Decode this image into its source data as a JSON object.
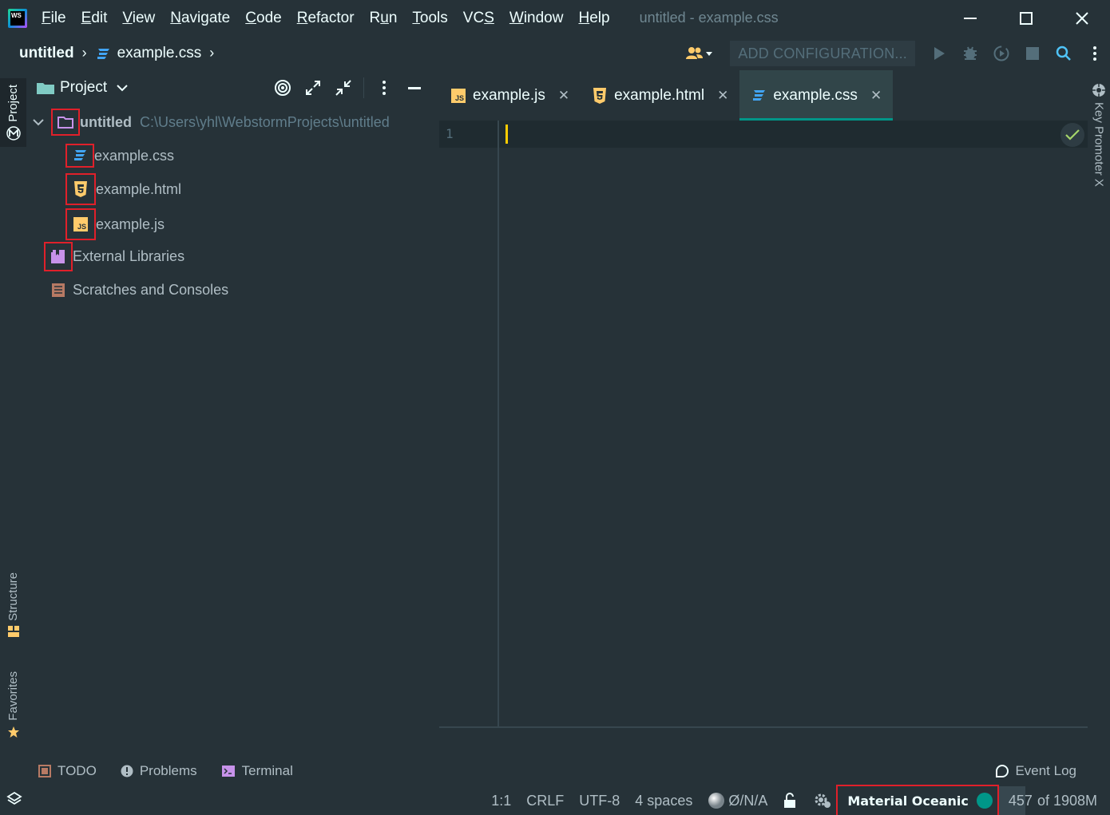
{
  "menu": {
    "items": [
      {
        "label": "File",
        "mnemonic": "F"
      },
      {
        "label": "Edit",
        "mnemonic": "E"
      },
      {
        "label": "View",
        "mnemonic": "V"
      },
      {
        "label": "Navigate",
        "mnemonic": "N"
      },
      {
        "label": "Code",
        "mnemonic": "C"
      },
      {
        "label": "Refactor",
        "mnemonic": "R"
      },
      {
        "label": "Run",
        "mnemonic": "u"
      },
      {
        "label": "Tools",
        "mnemonic": "T"
      },
      {
        "label": "VCS",
        "mnemonic": "S"
      },
      {
        "label": "Window",
        "mnemonic": "W"
      },
      {
        "label": "Help",
        "mnemonic": "H"
      }
    ]
  },
  "window": {
    "title": "untitled - example.css",
    "logo_text": "WS"
  },
  "navbar": {
    "project": "untitled",
    "file": "example.css",
    "config_label": "ADD CONFIGURATION..."
  },
  "sidebar": {
    "project_tab": "Project",
    "structure_tab": "Structure",
    "favorites_tab": "Favorites",
    "key_promoter_tab": "Key Promoter X"
  },
  "project_panel": {
    "title": "Project",
    "root": {
      "name": "untitled",
      "path": "C:\\Users\\yhl\\WebstormProjects\\untitled"
    },
    "files": [
      "example.css",
      "example.html",
      "example.js"
    ],
    "external_libraries": "External Libraries",
    "scratches": "Scratches and Consoles"
  },
  "editor": {
    "tabs": [
      {
        "label": "example.js",
        "icon": "js-file-icon"
      },
      {
        "label": "example.html",
        "icon": "html-file-icon"
      },
      {
        "label": "example.css",
        "icon": "css-file-icon",
        "active": true
      }
    ],
    "line_number": "1"
  },
  "bottom_tools": {
    "todo": "TODO",
    "problems": "Problems",
    "terminal": "Terminal",
    "event_log": "Event Log"
  },
  "statusbar": {
    "position": "1:1",
    "line_separator": "CRLF",
    "encoding": "UTF-8",
    "indent": "4 spaces",
    "vcs": "Ø/N/A",
    "theme": "Material Oceanic",
    "memory_used": "457",
    "memory_total": "of 1908M",
    "memory_fraction": 0.24
  },
  "colors": {
    "background": "#263238",
    "accent": "#009688",
    "highlight_box": "#e0202a",
    "caret": "#ffcc00"
  }
}
